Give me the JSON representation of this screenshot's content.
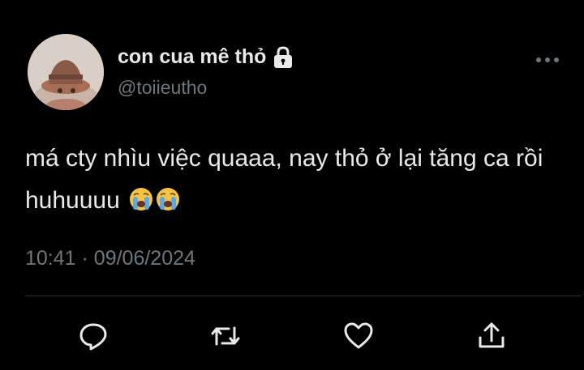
{
  "tweet": {
    "author": {
      "display_name": "con cua mê thỏ",
      "handle": "@toiieutho",
      "protected_icon": "lock-icon",
      "avatar": "avatar-photo"
    },
    "text": "má cty nhìu việc quaaa, nay thỏ ở lại tăng ca rồi huhuuuu",
    "emojis": [
      "loudly-crying-face",
      "loudly-crying-face"
    ],
    "time": "10:41",
    "separator": "·",
    "date": "09/06/2024",
    "actions": [
      "reply-icon",
      "retweet-icon",
      "like-icon",
      "share-icon"
    ],
    "menu_icon": "more-icon"
  },
  "colors": {
    "background": "#000000",
    "primary_text": "#e7e9ea",
    "secondary_text": "#71767b",
    "divider": "#2f3336"
  }
}
